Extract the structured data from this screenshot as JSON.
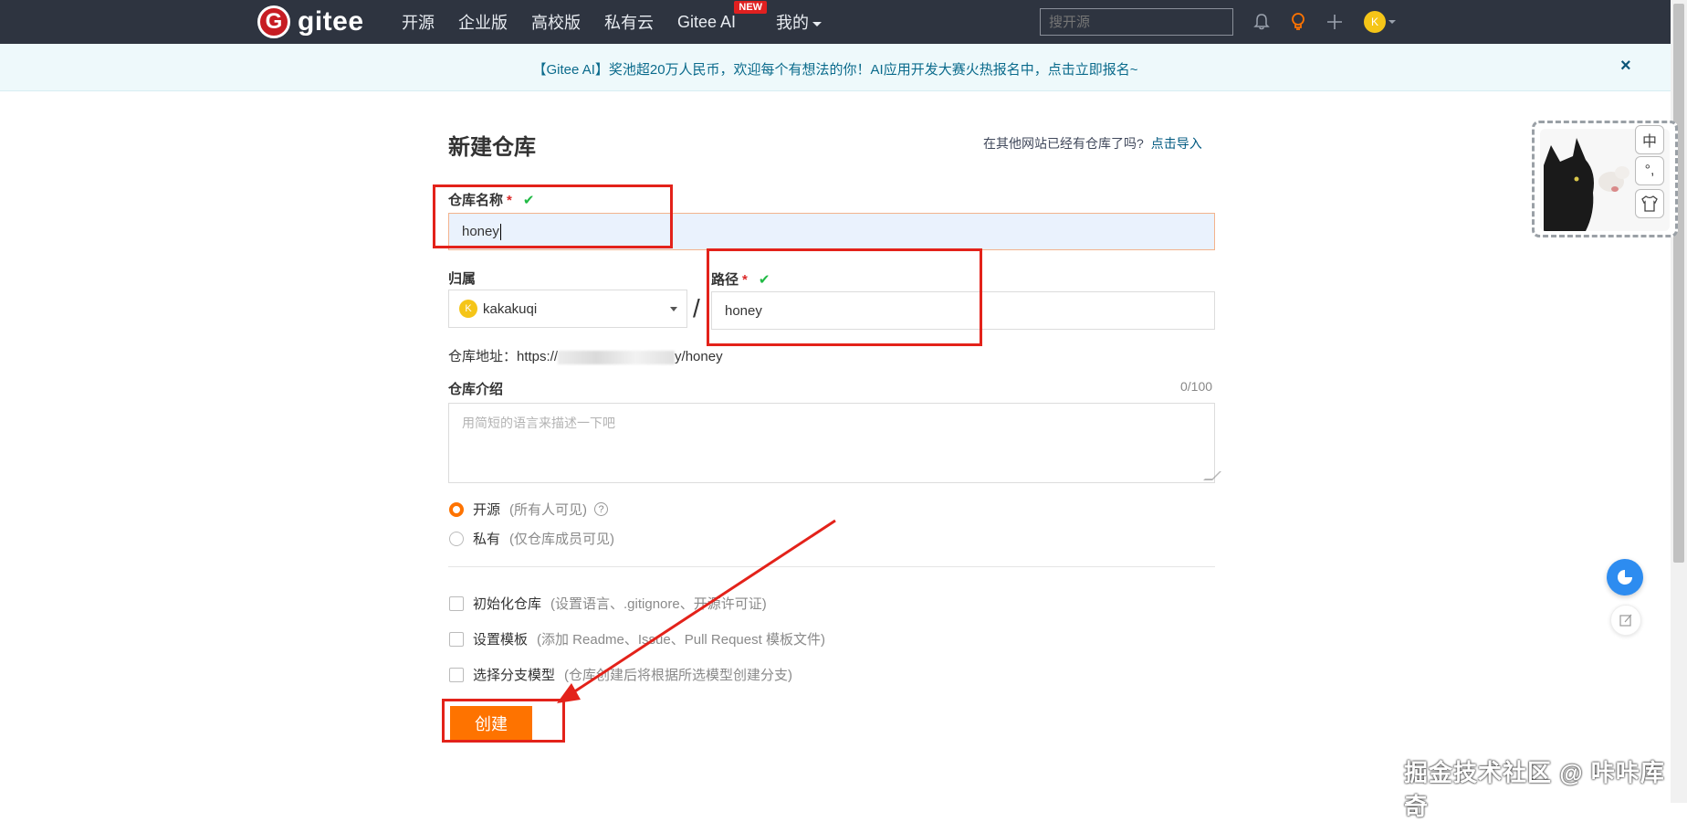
{
  "topnav": {
    "logo_badge": "G",
    "logo_text": "gitee",
    "items": [
      {
        "label": "开源"
      },
      {
        "label": "企业版"
      },
      {
        "label": "高校版"
      },
      {
        "label": "私有云"
      },
      {
        "label": "Gitee AI",
        "badge": "NEW"
      },
      {
        "label": "我的"
      }
    ],
    "search_placeholder": "搜开源",
    "avatar_letter": "K",
    "icons": [
      "bell-icon",
      "lightbulb-icon",
      "plus-icon"
    ]
  },
  "banner": {
    "text": "【Gitee AI】奖池超20万人民币，欢迎每个有想法的你！AI应用开发大赛火热报名中，点击立即报名~",
    "close": "×"
  },
  "page": {
    "title": "新建仓库",
    "import_hint": "在其他网站已经有仓库了吗?",
    "import_link": "点击导入"
  },
  "form": {
    "repo_name_label": "仓库名称",
    "required_mark": "*",
    "check_mark": "✔",
    "repo_name_value": "honey",
    "owner_label": "归属",
    "owner_value": "kakakuqi",
    "owner_avatar": "K",
    "separator": "/",
    "path_label": "路径",
    "path_value": "honey",
    "repo_addr_prefix": "仓库地址：https://",
    "repo_addr_suffix": "y/honey",
    "intro_label": "仓库介绍",
    "intro_counter": "0/100",
    "intro_placeholder": "用简短的语言来描述一下吧",
    "visibility": [
      {
        "label": "开源",
        "hint": "(所有人可见)",
        "selected": true
      },
      {
        "label": "私有",
        "hint": "(仅仓库成员可见)",
        "selected": false
      }
    ],
    "options": [
      {
        "label": "初始化仓库",
        "hint": "(设置语言、.gitignore、开源许可证)"
      },
      {
        "label": "设置模板",
        "hint": "(添加 Readme、Issue、Pull Request 模板文件)"
      },
      {
        "label": "选择分支模型",
        "hint": "(仓库创建后将根据所选模型创建分支)"
      }
    ],
    "create_button": "创建"
  },
  "side_widget": {
    "tools": [
      "中",
      "°,",
      "👕"
    ]
  },
  "watermark": "掘金技术社区 @ 咔咔库奇",
  "colors": {
    "nav_bg": "#2e3440",
    "brand_red": "#c71d23",
    "primary_orange": "#fe7300",
    "annotation_red": "#e3221a",
    "banner_bg": "#eef9fb"
  }
}
